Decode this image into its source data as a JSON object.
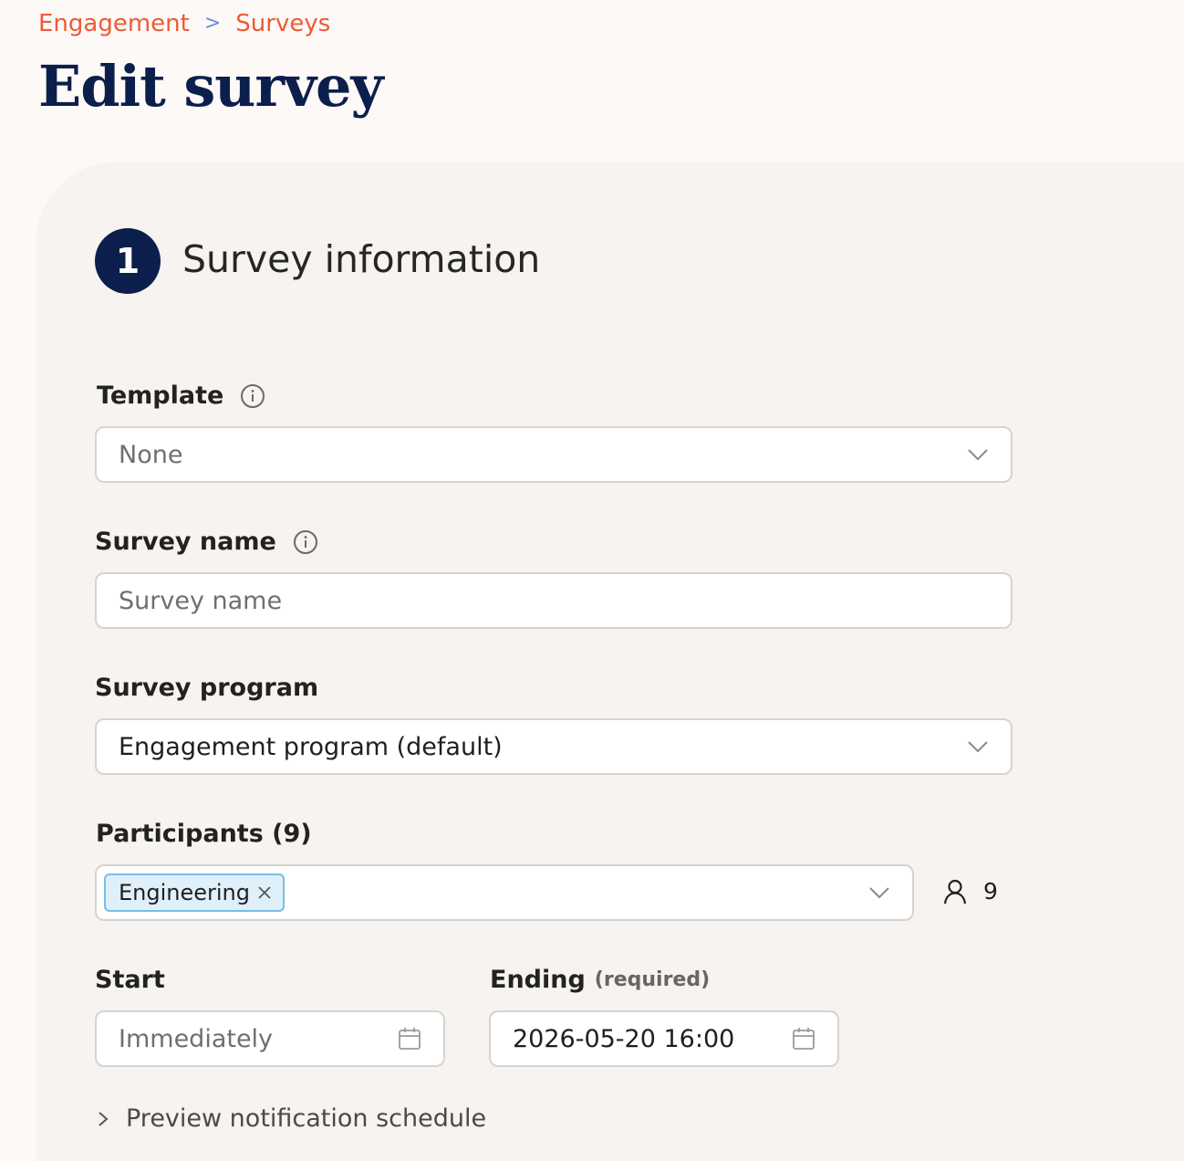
{
  "breadcrumb": {
    "items": [
      "Engagement",
      "Surveys"
    ],
    "separator": ">"
  },
  "page": {
    "title": "Edit survey"
  },
  "section": {
    "step_number": "1",
    "title": "Survey information"
  },
  "fields": {
    "template": {
      "label": "Template",
      "value": "None"
    },
    "survey_name": {
      "label": "Survey name",
      "placeholder": "Survey name",
      "value": ""
    },
    "survey_program": {
      "label": "Survey program",
      "value": "Engagement program (default)"
    },
    "participants": {
      "label": "Participants (9)",
      "tags": [
        "Engineering"
      ],
      "count": "9"
    },
    "start": {
      "label": "Start",
      "placeholder": "Immediately"
    },
    "ending": {
      "label": "Ending",
      "qualifier": "(required)",
      "value": "2026-05-20 16:00"
    }
  },
  "disclosure": {
    "label": "Preview notification schedule"
  },
  "icons": {
    "info": "info-circle-icon",
    "chevron": "chevron-down-icon",
    "person": "person-icon",
    "calendar": "calendar-icon",
    "close": "close-icon",
    "caret": "chevron-right-icon"
  },
  "colors": {
    "accent": "#ee5a36",
    "navy": "#0c1f4c",
    "tag_bg": "#dff0fb",
    "tag_border": "#79bce8"
  }
}
